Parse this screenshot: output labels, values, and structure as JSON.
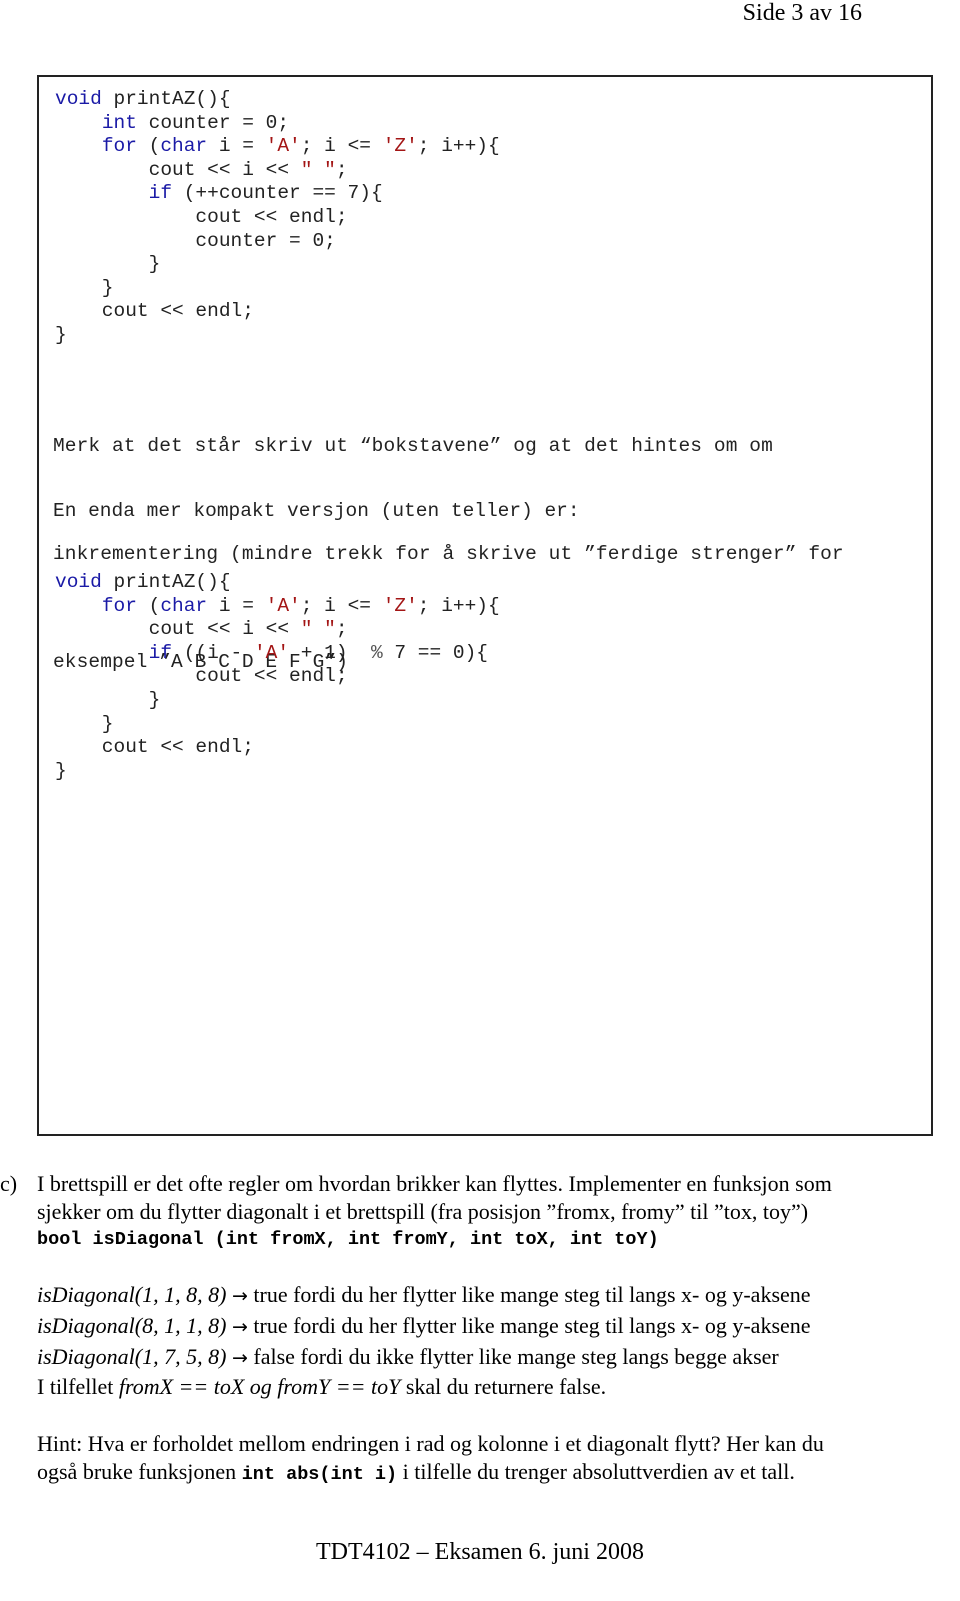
{
  "header": {
    "page_number": "Side 3 av 16"
  },
  "answer_box": {
    "code1": {
      "lines": [
        [
          {
            "t": "kw",
            "v": "void"
          },
          {
            "t": "n",
            "v": " printAZ(){"
          }
        ],
        [
          {
            "t": "n",
            "v": "    "
          },
          {
            "t": "kw",
            "v": "int"
          },
          {
            "t": "n",
            "v": " counter = 0;"
          }
        ],
        [
          {
            "t": "n",
            "v": "    "
          },
          {
            "t": "kw",
            "v": "for"
          },
          {
            "t": "n",
            "v": " ("
          },
          {
            "t": "kw",
            "v": "char"
          },
          {
            "t": "n",
            "v": " i = "
          },
          {
            "t": "str",
            "v": "'A'"
          },
          {
            "t": "n",
            "v": "; i <= "
          },
          {
            "t": "str",
            "v": "'Z'"
          },
          {
            "t": "n",
            "v": "; i++){"
          }
        ],
        [
          {
            "t": "n",
            "v": "        cout << i << "
          },
          {
            "t": "str",
            "v": "\" \""
          },
          {
            "t": "n",
            "v": ";"
          }
        ],
        [
          {
            "t": "n",
            "v": "        "
          },
          {
            "t": "kw",
            "v": "if"
          },
          {
            "t": "n",
            "v": " (++counter == 7){"
          }
        ],
        [
          {
            "t": "n",
            "v": "            cout << endl;"
          }
        ],
        [
          {
            "t": "n",
            "v": "            counter = 0;"
          }
        ],
        [
          {
            "t": "n",
            "v": "        }"
          }
        ],
        [
          {
            "t": "n",
            "v": "    }"
          }
        ],
        [
          {
            "t": "n",
            "v": "    cout << endl;"
          }
        ],
        [
          {
            "t": "n",
            "v": "}"
          }
        ]
      ]
    },
    "note_lines": [
      "Merk at det står skriv ut “bokstavene” og at det hintes om om",
      "inkrementering (mindre trekk for å skrive ut ”ferdige strenger” for",
      "eksempel ”A B C D E F G”)"
    ],
    "compact_label": "En enda mer kompakt versjon (uten teller) er:",
    "code2": {
      "lines": [
        [
          {
            "t": "kw",
            "v": "void"
          },
          {
            "t": "n",
            "v": " printAZ(){"
          }
        ],
        [
          {
            "t": "n",
            "v": "    "
          },
          {
            "t": "kw",
            "v": "for"
          },
          {
            "t": "n",
            "v": " ("
          },
          {
            "t": "kw",
            "v": "char"
          },
          {
            "t": "n",
            "v": " i = "
          },
          {
            "t": "str",
            "v": "'A'"
          },
          {
            "t": "n",
            "v": "; i <= "
          },
          {
            "t": "str",
            "v": "'Z'"
          },
          {
            "t": "n",
            "v": "; i++){"
          }
        ],
        [
          {
            "t": "n",
            "v": "        cout << i << "
          },
          {
            "t": "str",
            "v": "\" \""
          },
          {
            "t": "n",
            "v": ";"
          }
        ],
        [
          {
            "t": "n",
            "v": "        "
          },
          {
            "t": "kw",
            "v": "if"
          },
          {
            "t": "n",
            "v": " ((i - "
          },
          {
            "t": "str",
            "v": "'A'"
          },
          {
            "t": "n",
            "v": " + 1)  "
          },
          {
            "t": "op",
            "v": "%"
          },
          {
            "t": "n",
            "v": " 7 == 0){"
          }
        ],
        [
          {
            "t": "n",
            "v": "            cout << endl;"
          }
        ],
        [
          {
            "t": "n",
            "v": "        }"
          }
        ],
        [
          {
            "t": "n",
            "v": "    }"
          }
        ],
        [
          {
            "t": "n",
            "v": "    cout << endl;"
          }
        ],
        [
          {
            "t": "n",
            "v": "}"
          }
        ]
      ]
    }
  },
  "task": {
    "label": "c)",
    "intro_line1": "I brettspill er det ofte regler om hvordan brikker kan flyttes. Implementer en funksjon som",
    "intro_line2": "sjekker om du flytter diagonalt i et brettspill (fra posisjon ”fromx, fromy” til ”tox, toy”)",
    "signature": "bool isDiagonal (int fromX, int fromY, int toX, int toY)",
    "examples": [
      {
        "call": "isDiagonal(1, 1, 8, 8)",
        "arrow": "→",
        "result": " true fordi du her flytter like mange steg til langs x- og y-aksene"
      },
      {
        "call": "isDiagonal(8, 1, 1, 8)",
        "arrow": "→",
        "result": " true fordi du her flytter like mange steg til langs x- og y-aksene"
      },
      {
        "call": "isDiagonal(1, 7, 5, 8)",
        "arrow": "→",
        "result": " false fordi du ikke flytter like mange steg langs begge akser"
      }
    ],
    "edge_case": {
      "prefix": "I tilfellet ",
      "condition": "fromX == toX og fromY == toY",
      "suffix": " skal du returnere false."
    },
    "hint": {
      "line1": "Hint: Hva er forholdet mellom endringen i rad og kolonne i et diagonalt flytt? Her kan du",
      "line2_prefix": "også bruke funksjonen ",
      "line2_code": "int abs(int i)",
      "line2_suffix": " i tilfelle du trenger absoluttverdien av et tall."
    }
  },
  "footer": {
    "text": "TDT4102 – Eksamen 6. juni 2008"
  }
}
